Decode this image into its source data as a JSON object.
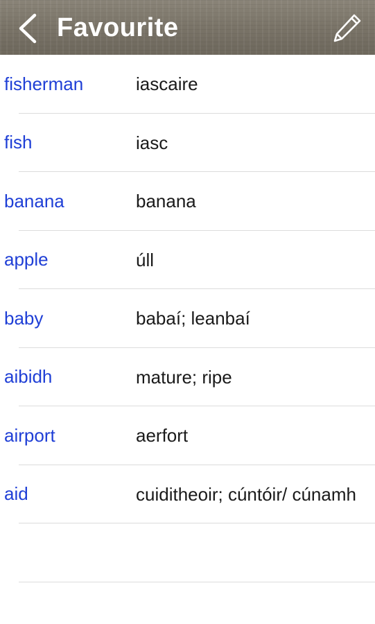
{
  "navbar": {
    "title": "Favourite",
    "back_icon": "chevron-left-icon",
    "edit_icon": "pencil-icon"
  },
  "entries": [
    {
      "word": "fisherman",
      "translation": "iascaire"
    },
    {
      "word": "fish",
      "translation": "iasc"
    },
    {
      "word": "banana",
      "translation": "banana"
    },
    {
      "word": "apple",
      "translation": "úll"
    },
    {
      "word": "baby",
      "translation": "babaí; leanbaí"
    },
    {
      "word": "aibidh",
      "translation": "mature; ripe"
    },
    {
      "word": "airport",
      "translation": "aerfort"
    },
    {
      "word": "aid",
      "translation": "cuiditheoir; cúntóir/ cúnamh"
    }
  ],
  "colors": {
    "word": "#1f3fd6",
    "translation": "#1a1a1a",
    "separator": "#dcdcdc",
    "nav_text": "#ffffff"
  }
}
